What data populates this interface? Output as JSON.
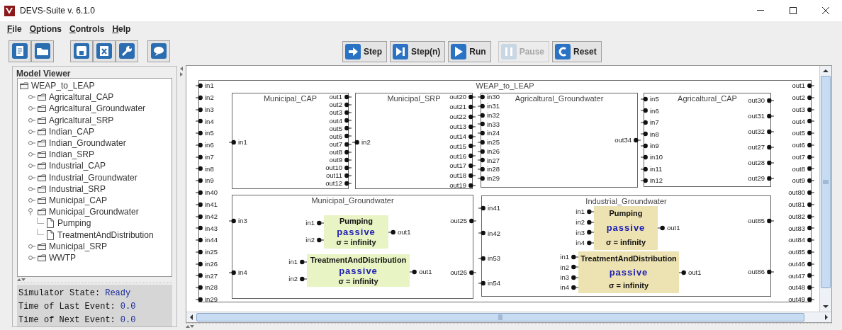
{
  "window": {
    "title": "DEVS-Suite v. 6.1.0"
  },
  "menu": [
    "File",
    "Options",
    "Controls",
    "Help"
  ],
  "sim_controls": [
    {
      "kind": "step",
      "label": "Step",
      "disabled": false
    },
    {
      "kind": "step_n",
      "label": "Step(n)",
      "disabled": false
    },
    {
      "kind": "run",
      "label": "Run",
      "disabled": false
    },
    {
      "kind": "pause",
      "label": "Pause",
      "disabled": true
    },
    {
      "kind": "reset",
      "label": "Reset",
      "disabled": false
    }
  ],
  "model_viewer": {
    "title": "Model Viewer",
    "tree": {
      "label": "WEAP_to_LEAP",
      "kind": "folder",
      "children": [
        {
          "label": "Agricaltural_CAP",
          "kind": "folder",
          "expanded": false
        },
        {
          "label": "Agricaltural_Groundwater",
          "kind": "folder",
          "expanded": false
        },
        {
          "label": "Agricaltural_SRP",
          "kind": "folder",
          "expanded": false
        },
        {
          "label": "Indian_CAP",
          "kind": "folder",
          "expanded": false
        },
        {
          "label": "Indian_Groundwater",
          "kind": "folder",
          "expanded": false
        },
        {
          "label": "Indian_SRP",
          "kind": "folder",
          "expanded": false
        },
        {
          "label": "Industrial_CAP",
          "kind": "folder",
          "expanded": false
        },
        {
          "label": "Industrial_Groundwater",
          "kind": "folder",
          "expanded": false
        },
        {
          "label": "Industrial_SRP",
          "kind": "folder",
          "expanded": false
        },
        {
          "label": "Municipal_CAP",
          "kind": "folder",
          "expanded": false
        },
        {
          "label": "Municipal_Groundwater",
          "kind": "folder",
          "expanded": true,
          "children": [
            {
              "label": "Pumping",
              "kind": "file"
            },
            {
              "label": "TreatmentAndDistribution",
              "kind": "file"
            }
          ]
        },
        {
          "label": "Municipal_SRP",
          "kind": "folder",
          "expanded": false
        },
        {
          "label": "WWTP",
          "kind": "folder",
          "expanded": false
        }
      ]
    }
  },
  "status": [
    {
      "label": "Simulator State:",
      "value": "Ready"
    },
    {
      "label": "Time of Last Event:",
      "value": "0.0"
    },
    {
      "label": "Time of Next Event:",
      "value": "0.0"
    }
  ],
  "diagram": {
    "title": "WEAP_to_LEAP",
    "inputs": [
      "in1",
      "in2",
      "in3",
      "in4",
      "in5",
      "in6",
      "in7",
      "in8",
      "in9",
      "in40",
      "in41",
      "in42",
      "in43",
      "in44",
      "in25",
      "in26",
      "in27",
      "in28",
      "in29"
    ],
    "outputs": [
      "out1",
      "out2",
      "out3",
      "out4",
      "out5",
      "out6",
      "out7",
      "out8",
      "out9",
      "out80",
      "out81",
      "out82",
      "out83",
      "out84",
      "out85",
      "out46",
      "out47",
      "out48",
      "out49"
    ],
    "blocks": [
      {
        "kind": "coupled",
        "name": "Municipal_CAP",
        "inputs": [
          "in1"
        ],
        "outputs": [
          "out1",
          "out2",
          "out3",
          "out4",
          "out5",
          "out6",
          "out7",
          "out8",
          "out9",
          "out10",
          "out11",
          "out12"
        ]
      },
      {
        "kind": "coupled",
        "name": "Municipal_SRP",
        "inputs": [
          "in2"
        ],
        "outputs": [
          "out20",
          "out21",
          "out22",
          "out13",
          "out14",
          "out15",
          "out16",
          "out17",
          "out18",
          "out19"
        ]
      },
      {
        "kind": "coupled",
        "name": "Agricaltural_Groundwater",
        "inputs": [
          "in30",
          "in31",
          "in32",
          "in33",
          "in24",
          "in25",
          "in26",
          "in27",
          "in28",
          "in29"
        ],
        "outputs": [
          "out34"
        ]
      },
      {
        "kind": "coupled",
        "name": "Agricaltural_CAP",
        "inputs": [
          "in5",
          "in6",
          "in7",
          "in8",
          "in9",
          "in10",
          "in11",
          "in12"
        ],
        "outputs": [
          "out30",
          "out31",
          "out32",
          "out27",
          "out28",
          "out29"
        ]
      },
      {
        "kind": "coupled",
        "name": "Municipal_Groundwater",
        "inputs": [
          "in3",
          "in4"
        ],
        "outputs": [
          "out25",
          "out26"
        ],
        "children": [
          {
            "kind": "atomic",
            "name": "Pumping",
            "phase": "passive",
            "sigma": "σ = infinity",
            "color": "#e8f4c4",
            "inputs": [
              "in1",
              "in2"
            ],
            "outputs": [
              "out1"
            ]
          },
          {
            "kind": "atomic",
            "name": "TreatmentAndDistribution",
            "phase": "passive",
            "sigma": "σ = infinity",
            "color": "#e8f4c4",
            "inputs": [
              "in1",
              "in2"
            ],
            "outputs": [
              "out1"
            ]
          }
        ]
      },
      {
        "kind": "coupled",
        "name": "Industrial_Groundwater",
        "inputs": [
          "in41",
          "in42",
          "in53",
          "in54"
        ],
        "outputs": [
          "out85",
          "out86"
        ],
        "children": [
          {
            "kind": "atomic",
            "name": "Pumping",
            "phase": "passive",
            "sigma": "σ = infinity",
            "color": "#ece2b2",
            "inputs": [
              "in1",
              "in2",
              "in3",
              "in4"
            ],
            "outputs": [
              "out1"
            ]
          },
          {
            "kind": "atomic",
            "name": "TreatmentAndDistribution",
            "phase": "passive",
            "sigma": "σ = infinity",
            "color": "#ece2b2",
            "inputs": [
              "in1",
              "in2",
              "in3",
              "in4"
            ],
            "outputs": [
              "out1"
            ]
          }
        ]
      }
    ]
  }
}
